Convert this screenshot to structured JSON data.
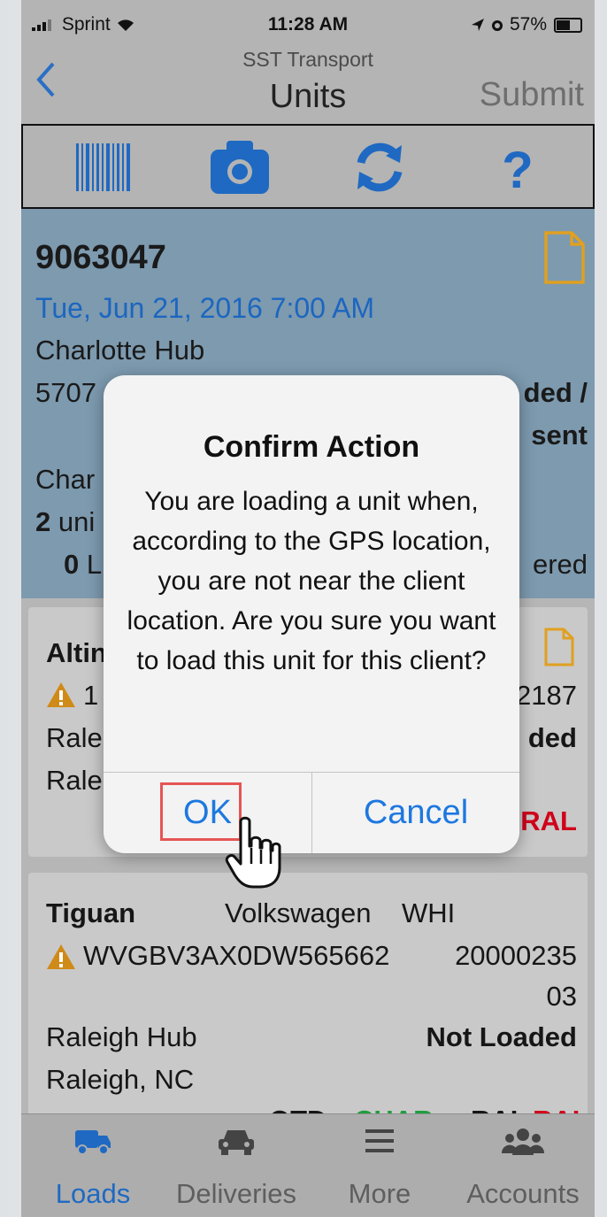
{
  "status_bar": {
    "carrier": "Sprint",
    "time": "11:28 AM",
    "battery": "57%"
  },
  "nav": {
    "subtitle": "SST Transport",
    "title": "Units",
    "submit_label": "Submit"
  },
  "summary": {
    "load_number": "9063047",
    "date": "Tue, Jun 21, 2016 7:00 AM",
    "hub": "Charlotte Hub",
    "address_fragment": "5707",
    "status_line1": "ded /",
    "status_line2": "sent",
    "city_fragment": "Char",
    "units_count": "2",
    "units_fragment": " uni",
    "loaded_count": "0",
    "loaded_fragment": " L",
    "delivered_fragment": "ered"
  },
  "card1": {
    "title_fragment": "Altin",
    "vin_fragment": "1",
    "code_fragment": "2187",
    "hub_fragment": "Rale",
    "status_fragment": "ded",
    "city_fragment": "Rale",
    "flag_fragment": "RAL"
  },
  "card2": {
    "model": "Tiguan",
    "make": "Volkswagen",
    "color": "WHI",
    "vin": "WVGBV3AX0DW565662",
    "code_line1": "20000235",
    "code_line2": "03",
    "hub": "Raleigh Hub",
    "status": "Not Loaded",
    "city": "Raleigh, NC",
    "partial_left": "OTD",
    "partial_mid": "CHAR",
    "partial_right1": "RAL",
    "partial_right2": "RAL"
  },
  "dialog": {
    "title": "Confirm Action",
    "message": "You are loading a unit when, according to the GPS location, you are not near the client location. Are you sure you want to load this unit for this client?",
    "ok_label": "OK",
    "cancel_label": "Cancel"
  },
  "tabs": [
    {
      "label": "Loads",
      "icon": "truck-icon"
    },
    {
      "label": "Deliveries",
      "icon": "car-icon"
    },
    {
      "label": "More",
      "icon": "menu-icon"
    },
    {
      "label": "Accounts",
      "icon": "users-icon"
    }
  ],
  "colors": {
    "accent": "#1d78e0",
    "active_tab": "#1f69c2",
    "warning": "#d08a17",
    "alert_red": "#d0021b",
    "doc_icon": "#e0a020"
  }
}
